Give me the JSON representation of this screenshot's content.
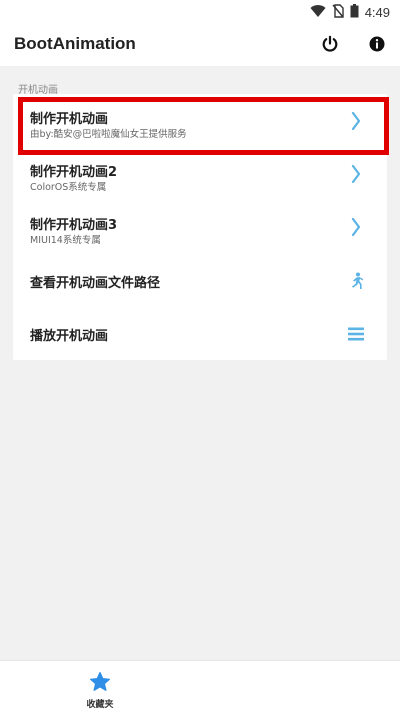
{
  "status_bar": {
    "time": "4:49",
    "icons": [
      "wifi-icon",
      "no-sim-icon",
      "battery-icon"
    ]
  },
  "app_bar": {
    "title": "BootAnimation",
    "actions": [
      "power-icon",
      "info-icon"
    ]
  },
  "section": {
    "label": "开机动画"
  },
  "menu": {
    "items": [
      {
        "title": "制作开机动画",
        "subtitle": "由by:酷安@巴啦啦魔仙女王提供服务",
        "icon": "chevron-right-icon"
      },
      {
        "title": "制作开机动画2",
        "subtitle": "ColorOS系统专属",
        "icon": "chevron-right-icon"
      },
      {
        "title": "制作开机动画3",
        "subtitle": "MIUI14系统专属",
        "icon": "chevron-right-icon"
      },
      {
        "title": "查看开机动画文件路径",
        "subtitle": "",
        "icon": "running-person-icon"
      },
      {
        "title": "播放开机动画",
        "subtitle": "",
        "icon": "menu-lines-icon"
      }
    ]
  },
  "bottom_nav": {
    "items": [
      {
        "label": "收藏夹",
        "icon": "star-icon"
      }
    ]
  },
  "colors": {
    "accent": "#2f8ee6",
    "icon_blue": "#5bb4e5",
    "highlight": "#e00000"
  }
}
